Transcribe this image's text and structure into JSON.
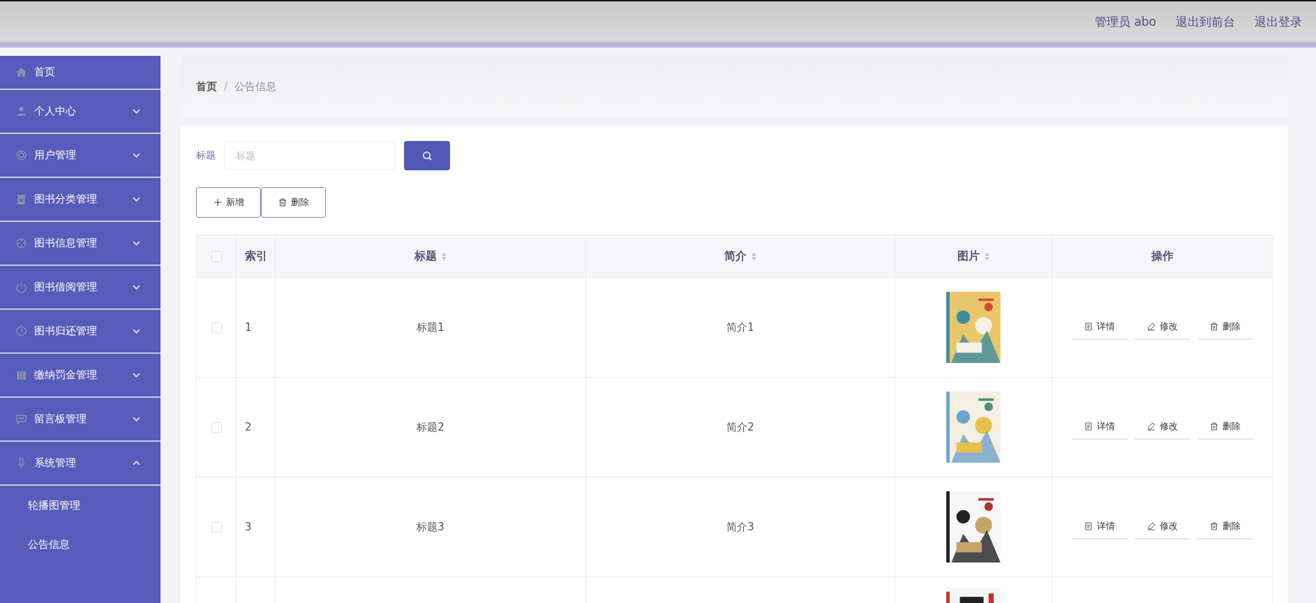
{
  "header": {
    "links": [
      "管理员 abo",
      "退出到前台",
      "退出登录"
    ]
  },
  "sidebar": {
    "items": [
      {
        "label": "首页",
        "expandable": false
      },
      {
        "label": "个人中心",
        "expandable": true,
        "expanded": false
      },
      {
        "label": "用户管理",
        "expandable": true,
        "expanded": false
      },
      {
        "label": "图书分类管理",
        "expandable": true,
        "expanded": false
      },
      {
        "label": "图书信息管理",
        "expandable": true,
        "expanded": false
      },
      {
        "label": "图书借阅管理",
        "expandable": true,
        "expanded": false
      },
      {
        "label": "图书归还管理",
        "expandable": true,
        "expanded": false
      },
      {
        "label": "缴纳罚金管理",
        "expandable": true,
        "expanded": false
      },
      {
        "label": "留言板管理",
        "expandable": true,
        "expanded": false
      },
      {
        "label": "系统管理",
        "expandable": true,
        "expanded": true,
        "children": [
          "轮播图管理",
          "公告信息"
        ]
      }
    ]
  },
  "breadcrumb": [
    "首页",
    "/",
    "公告信息"
  ],
  "search": {
    "label": "标题",
    "placeholder": "标题"
  },
  "actions": [
    "新增",
    "删除"
  ],
  "table": {
    "select_all_checked": false,
    "columns": [
      {
        "label": "索引",
        "sortable": false
      },
      {
        "label": "标题",
        "sortable": true
      },
      {
        "label": "简介",
        "sortable": true
      },
      {
        "label": "图片",
        "sortable": true
      },
      {
        "label": "操作",
        "sortable": false
      }
    ],
    "rows": [
      {
        "checked": false,
        "index": "1",
        "title": "标题1",
        "intro": "简介1",
        "ops": [
          "详情",
          "修改",
          "删除"
        ]
      },
      {
        "checked": false,
        "index": "2",
        "title": "标题2",
        "intro": "简介2",
        "ops": [
          "详情",
          "修改",
          "删除"
        ]
      },
      {
        "checked": false,
        "index": "3",
        "title": "标题3",
        "intro": "简介3",
        "ops": [
          "详情",
          "修改",
          "删除"
        ]
      }
    ]
  }
}
